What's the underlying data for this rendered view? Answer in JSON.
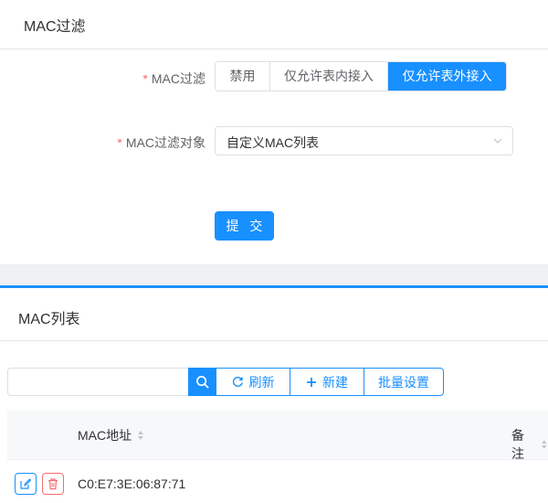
{
  "filter_panel": {
    "title": "MAC过滤",
    "mac_filter_label": "MAC过滤",
    "mode_options": [
      "禁用",
      "仅允许表内接入",
      "仅允许表外接入"
    ],
    "mode_selected_index": 2,
    "target_label": "MAC过滤对象",
    "target_value": "自定义MAC列表",
    "submit_label": "提 交",
    "required_mark": "*"
  },
  "list_panel": {
    "title": "MAC列表",
    "search_value": "",
    "refresh_label": "刷新",
    "new_label": "新建",
    "batch_label": "批量设置",
    "columns": [
      "MAC地址",
      "备注"
    ],
    "rows": [
      {
        "mac": "C0:E7:3E:06:87:71",
        "note": ""
      }
    ]
  },
  "colors": {
    "accent": "#1890ff",
    "danger": "#f56c6c"
  }
}
